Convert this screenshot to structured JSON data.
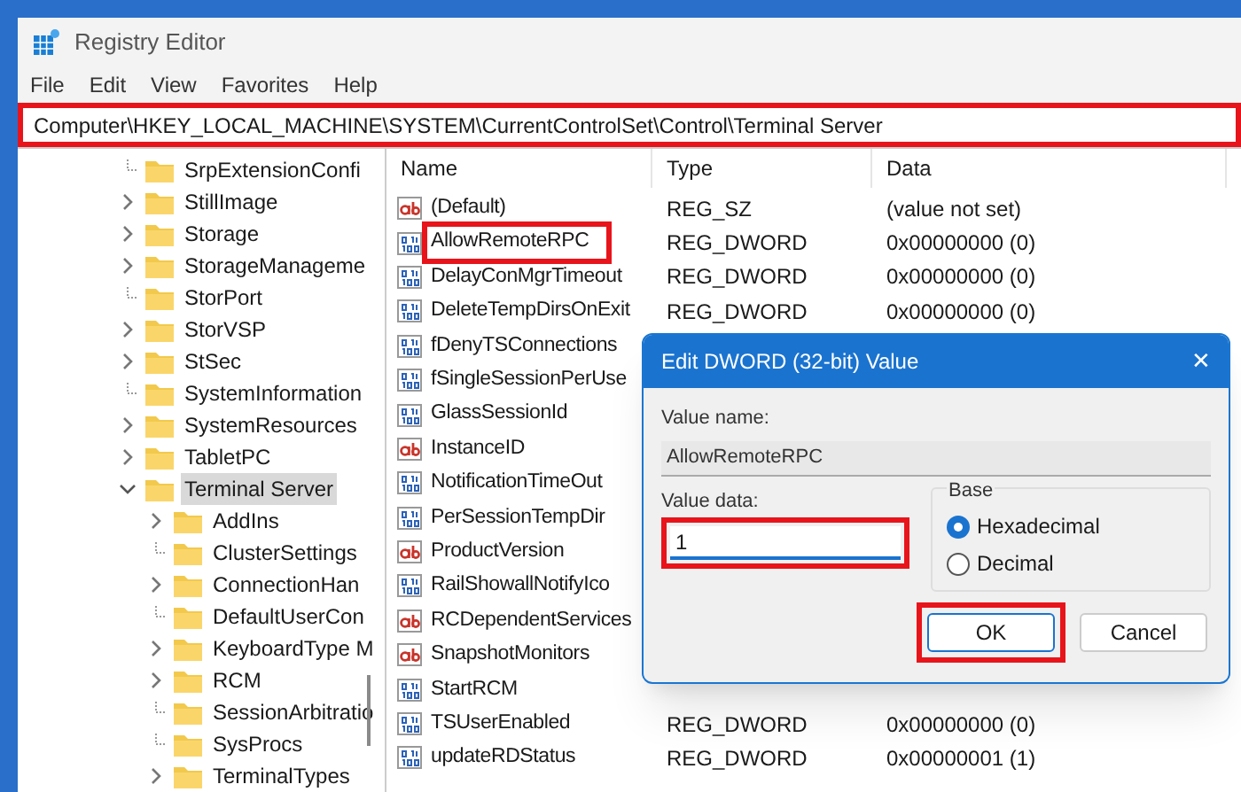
{
  "window": {
    "title": "Registry Editor"
  },
  "menu": [
    "File",
    "Edit",
    "View",
    "Favorites",
    "Help"
  ],
  "address_bar": {
    "path": "Computer\\HKEY_LOCAL_MACHINE\\SYSTEM\\CurrentControlSet\\Control\\Terminal Server",
    "highlighted": true
  },
  "tree": [
    {
      "label": "SrpExtensionConfi",
      "expandable": false,
      "selected": false
    },
    {
      "label": "StillImage",
      "expandable": true,
      "selected": false
    },
    {
      "label": "Storage",
      "expandable": true,
      "selected": false
    },
    {
      "label": "StorageManageme",
      "expandable": true,
      "selected": false
    },
    {
      "label": "StorPort",
      "expandable": false,
      "selected": false
    },
    {
      "label": "StorVSP",
      "expandable": true,
      "selected": false
    },
    {
      "label": "StSec",
      "expandable": true,
      "selected": false
    },
    {
      "label": "SystemInformation",
      "expandable": false,
      "selected": false
    },
    {
      "label": "SystemResources",
      "expandable": true,
      "selected": false
    },
    {
      "label": "TabletPC",
      "expandable": true,
      "selected": false
    },
    {
      "label": "Terminal Server",
      "expandable": true,
      "expanded": true,
      "selected": true,
      "children": [
        {
          "label": "AddIns",
          "expandable": true,
          "selected": false
        },
        {
          "label": "ClusterSettings",
          "expandable": false,
          "selected": false
        },
        {
          "label": "ConnectionHan",
          "expandable": true,
          "selected": false
        },
        {
          "label": "DefaultUserCon",
          "expandable": false,
          "selected": false
        },
        {
          "label": "KeyboardType M",
          "expandable": true,
          "selected": false
        },
        {
          "label": "RCM",
          "expandable": true,
          "selected": false
        },
        {
          "label": "SessionArbitratio",
          "expandable": false,
          "selected": false
        },
        {
          "label": "SysProcs",
          "expandable": false,
          "selected": false
        },
        {
          "label": "TerminalTypes",
          "expandable": true,
          "selected": false
        }
      ]
    }
  ],
  "values": {
    "columns": [
      "Name",
      "Type",
      "Data"
    ],
    "rows": [
      {
        "kind": "string",
        "name": "(Default)",
        "type": "REG_SZ",
        "data": "(value not set)",
        "highlighted": false
      },
      {
        "kind": "dword",
        "name": "AllowRemoteRPC",
        "type": "REG_DWORD",
        "data": "0x00000000 (0)",
        "highlighted": true
      },
      {
        "kind": "dword",
        "name": "DelayConMgrTimeout",
        "type": "REG_DWORD",
        "data": "0x00000000 (0)",
        "highlighted": false
      },
      {
        "kind": "dword",
        "name": "DeleteTempDirsOnExit",
        "type": "REG_DWORD",
        "data": "0x00000000 (0)",
        "highlighted": false
      },
      {
        "kind": "dword",
        "name": "fDenyTSConnections",
        "highlighted": false
      },
      {
        "kind": "dword",
        "name": "fSingleSessionPerUse",
        "highlighted": false
      },
      {
        "kind": "dword",
        "name": "GlassSessionId",
        "highlighted": false
      },
      {
        "kind": "string",
        "name": "InstanceID",
        "highlighted": false
      },
      {
        "kind": "dword",
        "name": "NotificationTimeOut",
        "highlighted": false
      },
      {
        "kind": "dword",
        "name": "PerSessionTempDir",
        "highlighted": false
      },
      {
        "kind": "string",
        "name": "ProductVersion",
        "highlighted": false
      },
      {
        "kind": "dword",
        "name": "RailShowallNotifyIco",
        "highlighted": false
      },
      {
        "kind": "string",
        "name": "RCDependentServices",
        "highlighted": false
      },
      {
        "kind": "string",
        "name": "SnapshotMonitors",
        "highlighted": false
      },
      {
        "kind": "dword",
        "name": "StartRCM",
        "highlighted": false
      },
      {
        "kind": "dword",
        "name": "TSUserEnabled",
        "type": "REG_DWORD",
        "data": "0x00000000 (0)",
        "highlighted": false
      },
      {
        "kind": "dword",
        "name": "updateRDStatus",
        "type": "REG_DWORD",
        "data": "0x00000001 (1)",
        "highlighted": false
      }
    ]
  },
  "dialog": {
    "title": "Edit DWORD (32-bit) Value",
    "close": "✕",
    "value_name_label": "Value name:",
    "value_name": "AllowRemoteRPC",
    "value_data_label": "Value data:",
    "value_data": "1",
    "value_data_highlighted": true,
    "base_label": "Base",
    "bases": [
      {
        "label": "Hexadecimal",
        "selected": true
      },
      {
        "label": "Decimal",
        "selected": false
      }
    ],
    "buttons": [
      {
        "label": "OK",
        "default": true,
        "highlighted": true
      },
      {
        "label": "Cancel",
        "default": false
      }
    ]
  }
}
